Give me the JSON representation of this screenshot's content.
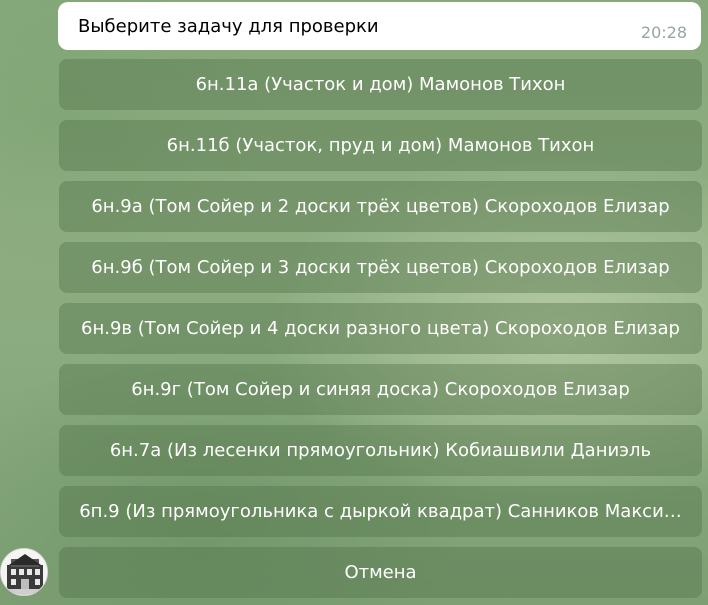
{
  "message": {
    "text": "Выберите задачу для проверки",
    "time": "20:28"
  },
  "keyboard": {
    "buttons": [
      {
        "label": "6н.11а (Участок и дом) Мамонов Тихон"
      },
      {
        "label": "6н.11б (Участок, пруд и дом) Мамонов Тихон"
      },
      {
        "label": "6н.9а (Том Сойер и 2 доски трёх цветов) Скороходов Елизар"
      },
      {
        "label": "6н.9б (Том Сойер и 3 доски трёх цветов) Скороходов Елизар"
      },
      {
        "label": "6н.9в (Том Сойер и 4 доски разного цвета) Скороходов Елизар"
      },
      {
        "label": "6н.9г (Том Сойер и синяя доска) Скороходов Елизар"
      },
      {
        "label": "6н.7а (Из лесенки прямоугольник) Кобиашвили Даниэль"
      },
      {
        "label": "6п.9 (Из прямоугольника с дыркой квадрат) Санников Макси…"
      },
      {
        "label": "Отмена"
      }
    ]
  },
  "avatar": {
    "icon": "bot-avatar-icon"
  }
}
